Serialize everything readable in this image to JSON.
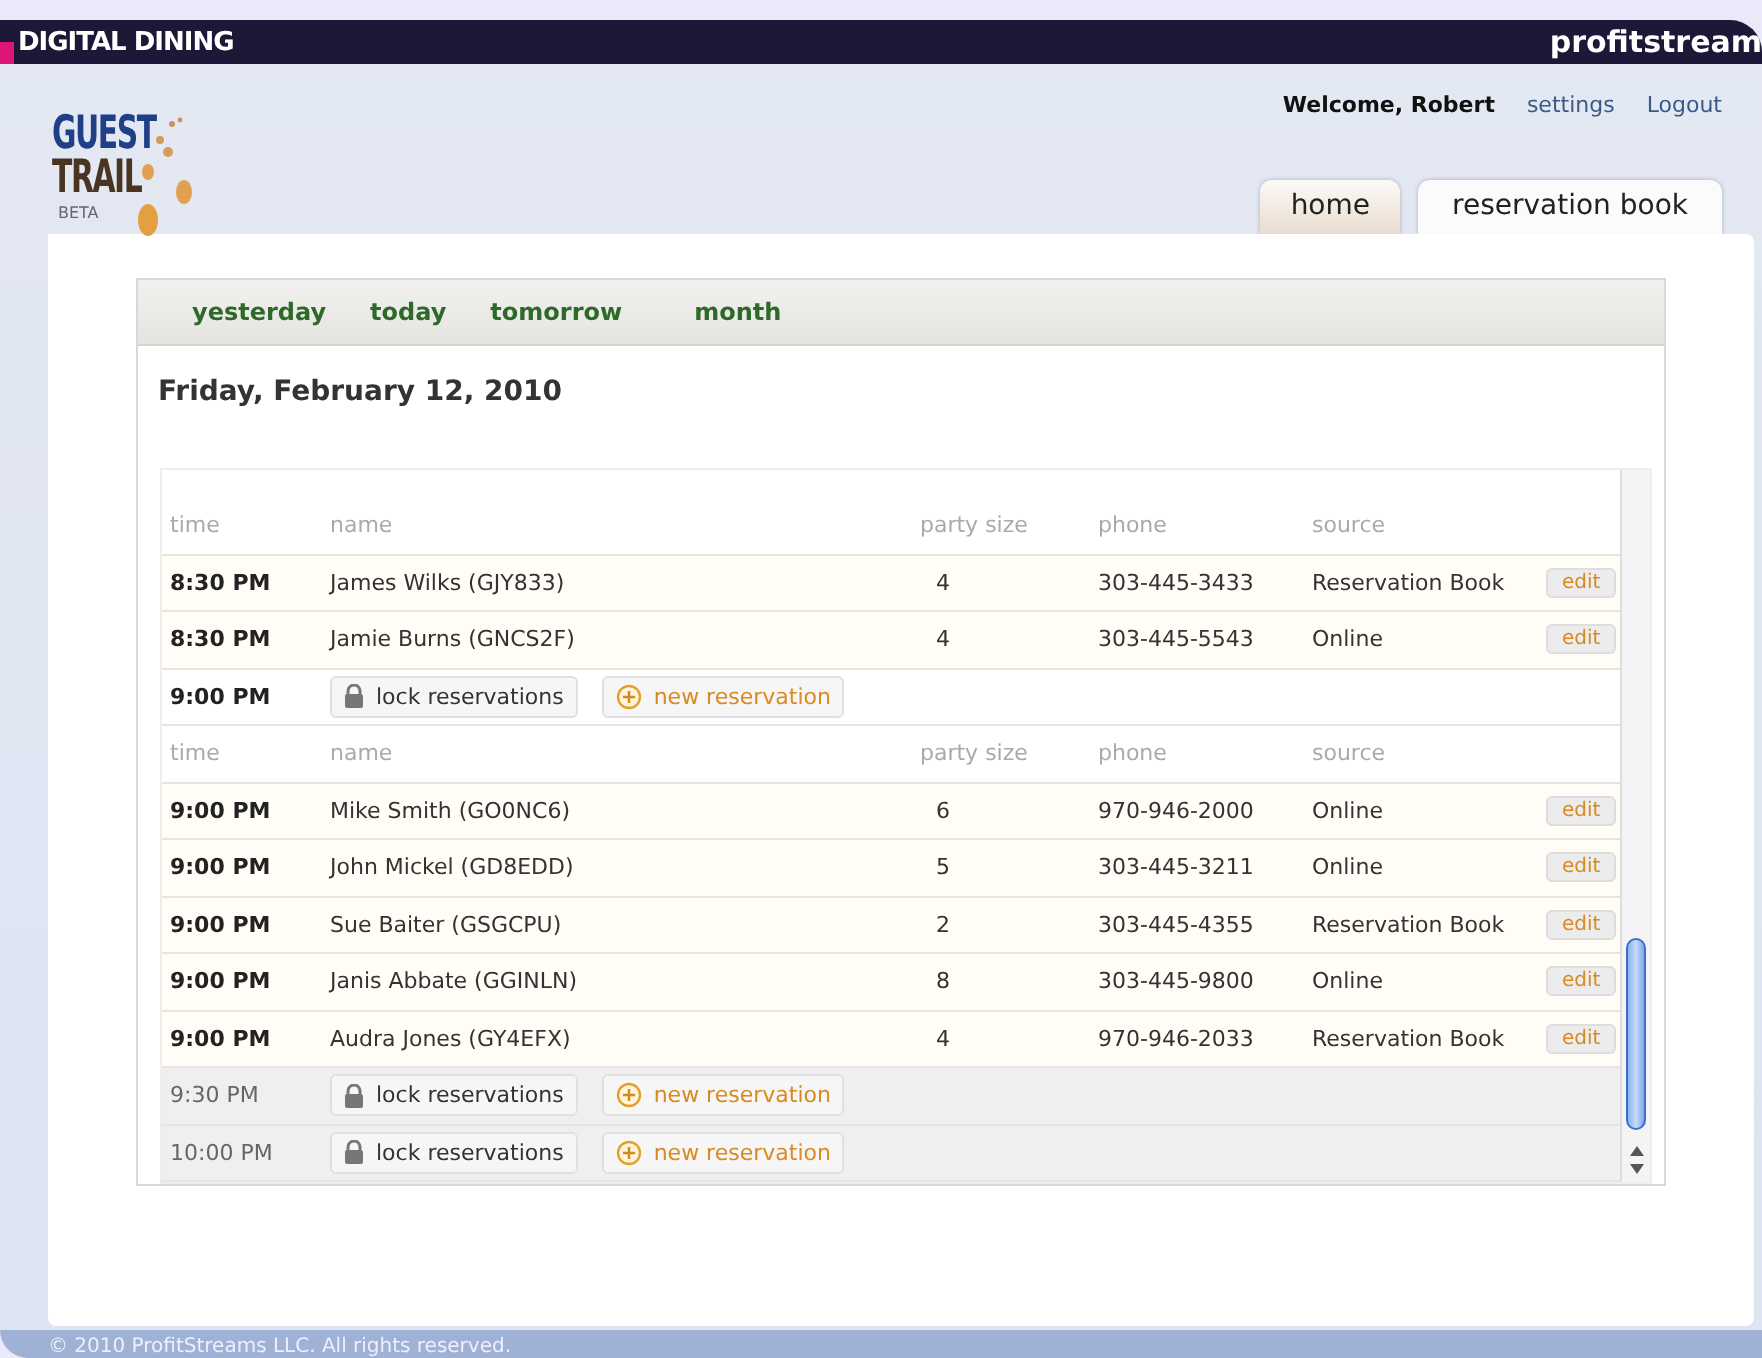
{
  "top_bar": {
    "brand": "DIGITAL DINING",
    "partner": "profitstream"
  },
  "user_bar": {
    "welcome": "Welcome, Robert",
    "links": [
      "settings",
      "Logout"
    ]
  },
  "logo": {
    "lines": [
      "GUEST",
      "TRAIL"
    ],
    "badge": "BETA"
  },
  "tabs": [
    {
      "label": "home",
      "selected": false
    },
    {
      "label": "reservation book",
      "selected": true
    }
  ],
  "day_nav": [
    "yesterday",
    "today",
    "tomorrow",
    "month"
  ],
  "date_heading": "Friday, February 12, 2010",
  "rows": [
    {
      "kind": "header",
      "columns": [
        "time",
        "name",
        "party size",
        "phone",
        "source"
      ]
    },
    {
      "kind": "reservation",
      "time": "8:30 PM",
      "name": "James Wilks (GJY833)",
      "party_size": "4",
      "phone": "303-445-3433",
      "source": "Reservation Book",
      "action": "edit"
    },
    {
      "kind": "reservation",
      "time": "8:30 PM",
      "name": "Jamie Burns (GNCS2F)",
      "party_size": "4",
      "phone": "303-445-5543",
      "source": "Online",
      "action": "edit"
    },
    {
      "kind": "slot",
      "time": "9:00 PM",
      "booked": true,
      "lock_label": "lock reservations",
      "new_label": "new reservation"
    },
    {
      "kind": "header",
      "columns": [
        "time",
        "name",
        "party size",
        "phone",
        "source"
      ]
    },
    {
      "kind": "reservation",
      "time": "9:00 PM",
      "name": "Mike Smith (GO0NC6)",
      "party_size": "6",
      "phone": "970-946-2000",
      "source": "Online",
      "action": "edit"
    },
    {
      "kind": "reservation",
      "time": "9:00 PM",
      "name": "John Mickel (GD8EDD)",
      "party_size": "5",
      "phone": "303-445-3211",
      "source": "Online",
      "action": "edit"
    },
    {
      "kind": "reservation",
      "time": "9:00 PM",
      "name": "Sue Baiter (GSGCPU)",
      "party_size": "2",
      "phone": "303-445-4355",
      "source": "Reservation Book",
      "action": "edit"
    },
    {
      "kind": "reservation",
      "time": "9:00 PM",
      "name": "Janis Abbate (GGINLN)",
      "party_size": "8",
      "phone": "303-445-9800",
      "source": "Online",
      "action": "edit"
    },
    {
      "kind": "reservation",
      "time": "9:00 PM",
      "name": "Audra Jones (GY4EFX)",
      "party_size": "4",
      "phone": "970-946-2033",
      "source": "Reservation Book",
      "action": "edit"
    },
    {
      "kind": "slot",
      "time": "9:30 PM",
      "booked": false,
      "lock_label": "lock reservations",
      "new_label": "new reservation"
    },
    {
      "kind": "slot",
      "time": "10:00 PM",
      "booked": false,
      "lock_label": "lock reservations",
      "new_label": "new reservation"
    }
  ],
  "footer": "© 2010 ProfitStreams LLC. All rights reserved."
}
